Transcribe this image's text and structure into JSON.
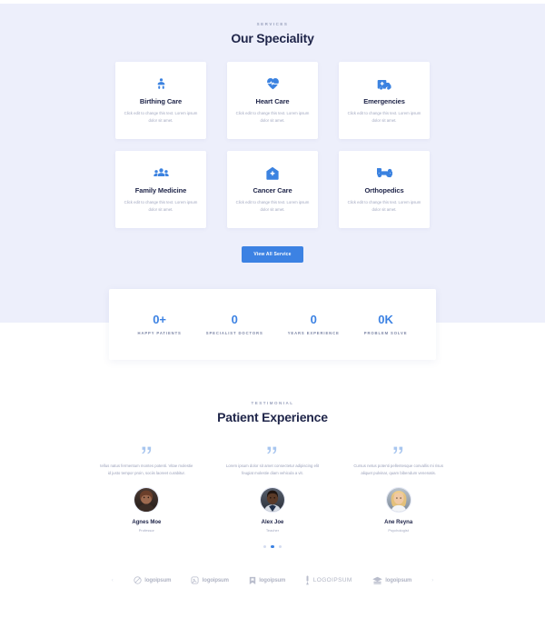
{
  "theme": {
    "accent": "#3c82e3",
    "band_bg": "#edeffb",
    "page_bg": "#ffffff",
    "heading_color": "#20264a",
    "muted_text": "#a2a8c0"
  },
  "services": {
    "eyebrow": "SERVICES",
    "title": "Our Speciality",
    "cards": [
      {
        "icon": "baby-icon",
        "title": "Birthing Care",
        "desc": "Click edit to change this text. Lorem ipsum dolor sit amet."
      },
      {
        "icon": "heart-pulse-icon",
        "title": "Heart Care",
        "desc": "Click edit to change this text. Lorem ipsum dolor sit amet."
      },
      {
        "icon": "ambulance-icon",
        "title": "Emergencies",
        "desc": "Click edit to change this text. Lorem ipsum dolor sit amet."
      },
      {
        "icon": "people-group-icon",
        "title": "Family Medicine",
        "desc": "Click edit to change this text. Lorem ipsum dolor sit amet."
      },
      {
        "icon": "hospital-home-icon",
        "title": "Cancer Care",
        "desc": "Click edit to change this text. Lorem ipsum dolor sit amet."
      },
      {
        "icon": "bone-icon",
        "title": "Orthopedics",
        "desc": "Click edit to change this text. Lorem ipsum dolor sit amet."
      }
    ],
    "cta_label": "View All Service"
  },
  "stats": [
    {
      "value": "0+",
      "label": "HAPPY PATIENTS"
    },
    {
      "value": "0",
      "label": "SPECIALIST DOCTORS"
    },
    {
      "value": "0",
      "label": "YEARS EXPERIENCE"
    },
    {
      "value": "0K",
      "label": "PROBLEM SOLVE"
    }
  ],
  "testimonials": {
    "eyebrow": "TESTIMONIAL",
    "title": "Patient Experience",
    "items": [
      {
        "quote_icon": "quote-mark-icon",
        "text": "tellus natus fermentum montes potenti. Vitae molestie id justo tempor proin, sociis laoreet curabitur.",
        "name": "Agnes Moe",
        "role": "Professor",
        "avatar": "avatar-agnes-moe"
      },
      {
        "quote_icon": "quote-mark-icon",
        "text": "Lorem ipsum dolor sit amet consectetur adipiscing elit feugiat molestie diam vehicula a vit.",
        "name": "Alex Joe",
        "role": "Teacher",
        "avatar": "avatar-alex-joe"
      },
      {
        "quote_icon": "quote-mark-icon",
        "text": "Cursus netus potenti pellentesque convallis mi risus aliquet pulvinar, quam bibendum venenatis.",
        "name": "Ane Reyna",
        "role": "Psychologist",
        "avatar": "avatar-ane-reyna"
      }
    ],
    "active_dot": 1,
    "dot_count": 3
  },
  "logos": {
    "prev_arrow": "‹",
    "next_arrow": "›",
    "items": [
      {
        "mark": "circle-slash-mark",
        "text": "logoipsum",
        "style": "lower"
      },
      {
        "mark": "rounded-square-mark",
        "text": "logoipsum",
        "style": "lower"
      },
      {
        "mark": "bookmark-mark",
        "text": "logoipsum",
        "style": "lower"
      },
      {
        "mark": "pin-mark",
        "text": "LOGOIPSUM",
        "style": "caps"
      },
      {
        "mark": "stack-mark",
        "text": "logoipsum",
        "style": "lower"
      }
    ]
  }
}
